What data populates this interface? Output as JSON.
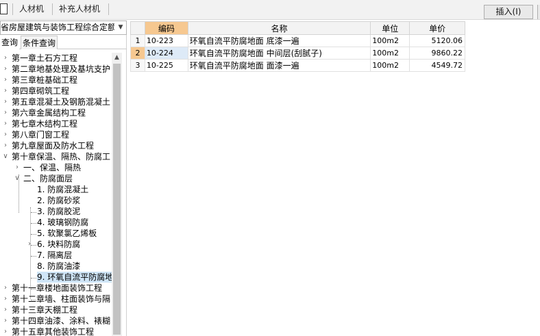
{
  "toolbar": {
    "tabs": [
      "人材机",
      "补充人材机"
    ],
    "insert_label": "插入(I)"
  },
  "left_panel": {
    "dropdown_value": "省房屋建筑与装饰工程综合定额",
    "subtabs": [
      "查询",
      "条件查询"
    ],
    "tree": [
      {
        "label": "第一章土石方工程"
      },
      {
        "label": "第二章地基处理及基坑支护"
      },
      {
        "label": "第三章桩基础工程"
      },
      {
        "label": "第四章砌筑工程"
      },
      {
        "label": "第五章混凝土及钢筋混凝土"
      },
      {
        "label": "第六章金属结构工程"
      },
      {
        "label": "第七章木结构工程"
      },
      {
        "label": "第八章门窗工程"
      },
      {
        "label": "第九章屋面及防水工程"
      },
      {
        "label": "第十章保温、隔热、防腐工"
      },
      {
        "label": "一、保温、隔热"
      },
      {
        "label": "二、防腐面层"
      },
      {
        "label": "1. 防腐混凝土"
      },
      {
        "label": "2. 防腐砂浆"
      },
      {
        "label": "3. 防腐胶泥"
      },
      {
        "label": "4. 玻璃钢防腐"
      },
      {
        "label": "5. 软聚氯乙烯板"
      },
      {
        "label": "6. 块料防腐"
      },
      {
        "label": "7. 隔离层"
      },
      {
        "label": "8. 防腐油漆"
      },
      {
        "label": "9. 环氧自流平防腐地"
      },
      {
        "label": "第十一章楼地面装饰工程"
      },
      {
        "label": "第十二章墙、柱面装饰与隔"
      },
      {
        "label": "第十三章天棚工程"
      },
      {
        "label": "第十四章油漆、涂料、裱糊"
      },
      {
        "label": "第十五章其他装饰工程"
      }
    ]
  },
  "grid": {
    "headers": [
      "",
      "编码",
      "名称",
      "单位",
      "单价"
    ],
    "rows": [
      {
        "num": "1",
        "code": "10-223",
        "name": "环氧自流平防腐地面 底漆一遍",
        "unit": "100m2",
        "price": "5120.06"
      },
      {
        "num": "2",
        "code": "10-224",
        "name": "环氧自流平防腐地面 中间层(刮腻子)",
        "unit": "100m2",
        "price": "9860.22"
      },
      {
        "num": "3",
        "code": "10-225",
        "name": "环氧自流平防腐地面 面漆一遍",
        "unit": "100m2",
        "price": "4549.72"
      }
    ]
  }
}
